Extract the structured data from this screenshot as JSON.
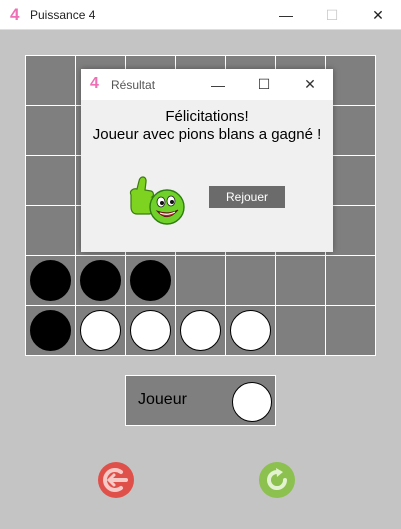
{
  "window": {
    "logo": "4",
    "title": "Puissance 4",
    "minimize": "—",
    "maximize": "☐",
    "close": "✕"
  },
  "board": {
    "rows": 6,
    "cols": 7,
    "cells": [
      [
        "",
        "",
        "",
        "",
        "",
        "",
        ""
      ],
      [
        "",
        "",
        "",
        "",
        "",
        "",
        ""
      ],
      [
        "",
        "",
        "",
        "",
        "",
        "",
        ""
      ],
      [
        "",
        "",
        "",
        "",
        "",
        "",
        ""
      ],
      [
        "black",
        "black",
        "black",
        "",
        "",
        "",
        ""
      ],
      [
        "black",
        "white",
        "white",
        "white",
        "white",
        "",
        ""
      ]
    ],
    "colors": {
      "cell": "#7f7f7f",
      "grid": "#ffffff",
      "black": "#000000",
      "white": "#ffffff"
    }
  },
  "dialog": {
    "logo": "4",
    "title": "Résultat",
    "minimize": "—",
    "maximize": "☐",
    "close": "✕",
    "message_line1": "Félicitations!",
    "message_line2": "Joueur avec pions blans a gagné !",
    "replay_label": "Rejouer",
    "icon": "thumbs-up-smiley-icon"
  },
  "player": {
    "label": "Joueur",
    "current_color": "white"
  },
  "buttons": {
    "exit_icon": "exit-arrow-icon",
    "restart_icon": "restart-icon"
  },
  "colors": {
    "accent": "#ee6fb6",
    "background": "#c4c4c4",
    "exit": "#e0504a",
    "restart": "#8cc04f"
  }
}
